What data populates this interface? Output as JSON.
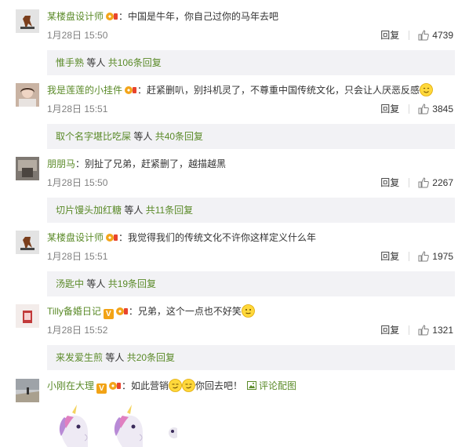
{
  "comments": [
    {
      "username": "某楼盘设计师",
      "text": "：中国是牛年，你自己过你的马年去吧",
      "date": "1月28日 15:50",
      "reply_label": "回复",
      "likes": "4739",
      "replies": {
        "name": "惟手熟",
        "middle": " 等人 ",
        "count": "共106条回复"
      },
      "avatar_color": "#cfcfcf"
    },
    {
      "username": "我是莲莲的小挂件",
      "text": "：赶紧删叭，别抖机灵了，不尊重中国传统文化，只会让人厌恶反感",
      "date": "1月28日 15:51",
      "reply_label": "回复",
      "likes": "3845",
      "replies": {
        "name": "取个名字堪比吃屎",
        "middle": " 等人 ",
        "count": "共40条回复"
      },
      "avatar_color": "#d7b8a6"
    },
    {
      "username": "朋朋马",
      "text": "：别扯了兄弟，赶紧删了，越描越黑",
      "date": "1月28日 15:50",
      "reply_label": "回复",
      "likes": "2267",
      "replies": {
        "name": "切片馒头加红糖",
        "middle": " 等人 ",
        "count": "共11条回复"
      },
      "avatar_color": "#8e8a84"
    },
    {
      "username": "某楼盘设计师",
      "text": "：我觉得我们的传统文化不许你这样定义什么年",
      "date": "1月28日 15:51",
      "reply_label": "回复",
      "likes": "1975",
      "replies": {
        "name": "汤匙中",
        "middle": " 等人 ",
        "count": "共19条回复"
      },
      "avatar_color": "#cfcfcf"
    },
    {
      "username": "Tilly备婚日记",
      "text": "：兄弟，这个一点也不好笑",
      "date": "1月28日 15:52",
      "reply_label": "回复",
      "likes": "1321",
      "replies": {
        "name": "来发爱生煎",
        "middle": " 等人 ",
        "count": "共20条回复"
      },
      "avatar_color": "#e9d6d4"
    },
    {
      "username": "小刚在大理",
      "text": "：如此营销",
      "text2": "你回去吧！",
      "pic_link": "评论配图",
      "avatar_color": "#b5b8bd"
    }
  ],
  "colors": {
    "link": "#5a8a28",
    "reply_bg": "#f2f2f5",
    "vip": "#f2a316"
  },
  "icons": {
    "like": "thumbs-up-icon",
    "badge": "member-badge-icon",
    "emoji": "smile-emoji-icon",
    "pic": "picture-icon"
  }
}
